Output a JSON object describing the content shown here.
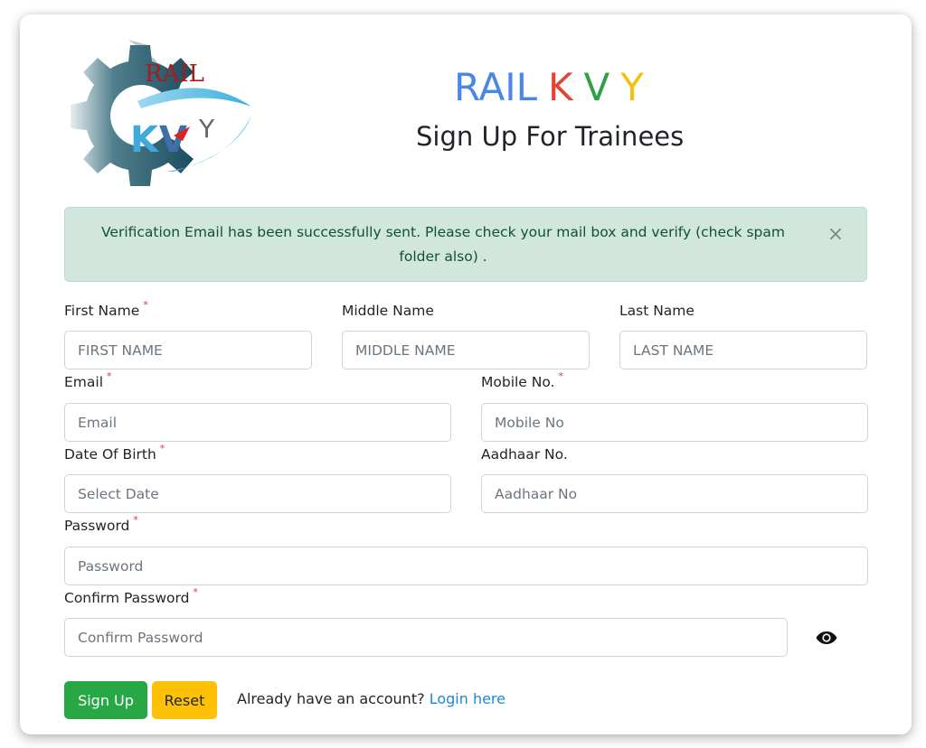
{
  "logo": {
    "top_text": "RAIL",
    "letters": [
      "K",
      "V",
      "Y"
    ]
  },
  "brand": {
    "rail": "RAIL",
    "k": "K",
    "v": "V",
    "y": "Y",
    "colors": {
      "rail": "#4a86e8",
      "k": "#e04536",
      "v": "#2ea043",
      "y": "#f4c20d"
    }
  },
  "page_title": "Sign Up For Trainees",
  "alert": {
    "message": "Verification Email has been successfully sent. Please check your mail box and verify (check spam folder also) .",
    "close_icon": "×"
  },
  "form": {
    "first_name": {
      "label": "First Name",
      "required": "*",
      "placeholder": "FIRST NAME",
      "value": ""
    },
    "middle_name": {
      "label": "Middle Name",
      "placeholder": "MIDDLE NAME",
      "value": ""
    },
    "last_name": {
      "label": "Last Name",
      "placeholder": "LAST NAME",
      "value": ""
    },
    "email": {
      "label": "Email",
      "required": "*",
      "placeholder": "Email",
      "value": ""
    },
    "mobile": {
      "label": "Mobile No.",
      "required": "*",
      "placeholder": "Mobile No",
      "value": ""
    },
    "dob": {
      "label": "Date Of Birth",
      "required": "*",
      "placeholder": "Select Date",
      "value": ""
    },
    "aadhaar": {
      "label": "Aadhaar No.",
      "placeholder": "Aadhaar No",
      "value": ""
    },
    "password": {
      "label": "Password",
      "required": "*",
      "placeholder": "Password",
      "value": ""
    },
    "confirm_password": {
      "label": "Confirm Password",
      "required": "*",
      "placeholder": "Confirm Password",
      "value": "",
      "toggle_icon": "eye-icon"
    }
  },
  "buttons": {
    "signup": "Sign Up",
    "reset": "Reset"
  },
  "login": {
    "prompt": "Already have an account?",
    "link": "Login here"
  },
  "colors": {
    "success": "#28a745",
    "warning": "#ffc107",
    "link": "#1a8ad6",
    "alert_bg": "#d1e7dd",
    "alert_text": "#0f5132",
    "required": "#dc3545"
  }
}
